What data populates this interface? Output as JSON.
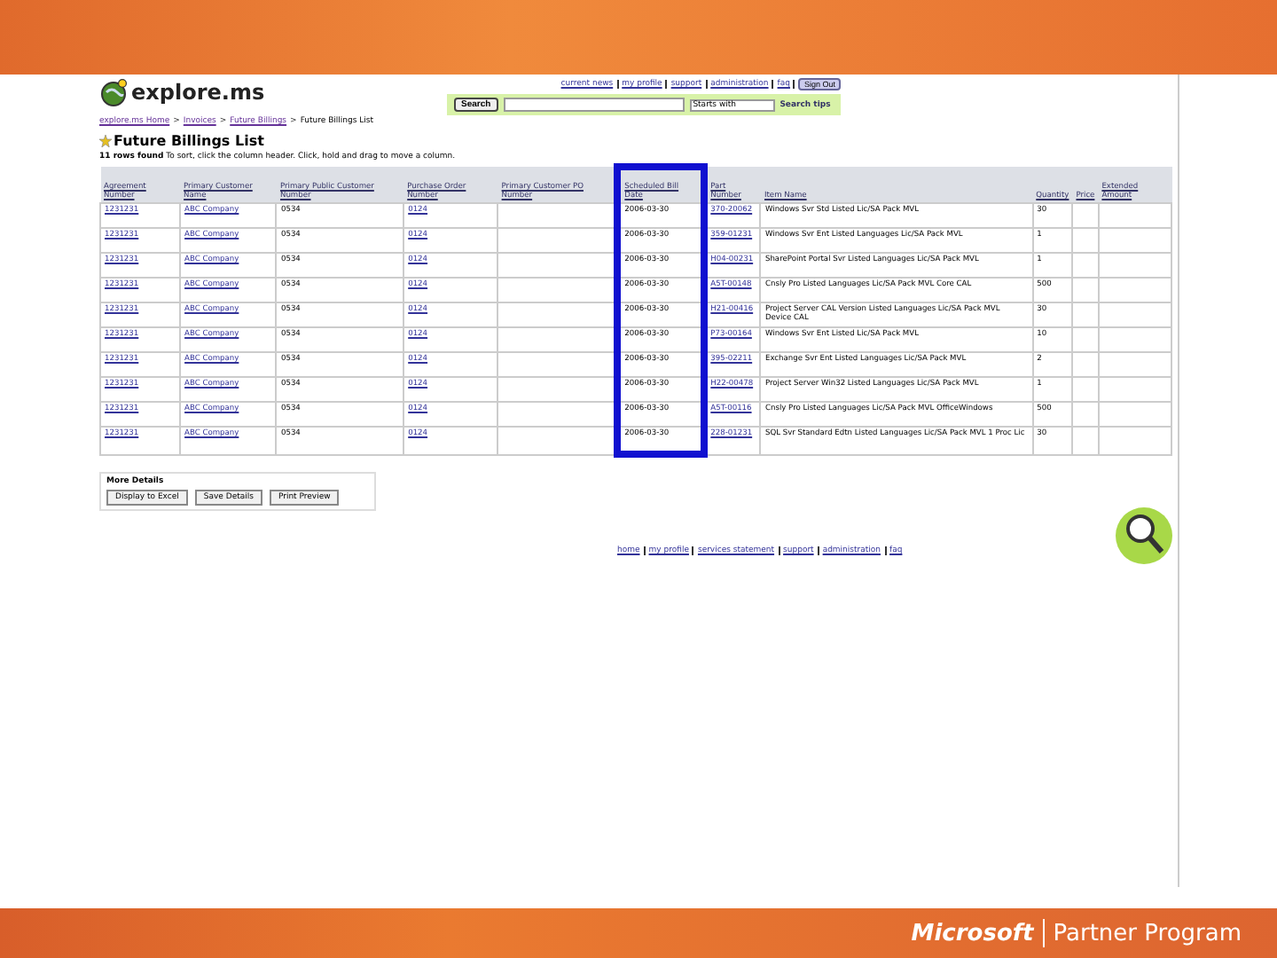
{
  "site": {
    "logo": "explore.ms",
    "top_links": [
      "current news",
      "my profile",
      "support",
      "administration",
      "faq"
    ],
    "sign_out": "Sign Out",
    "search_button": "Search",
    "search_mode": "Starts with",
    "search_tips": "Search tips"
  },
  "breadcrumb_separator": ">",
  "breadcrumb": [
    "explore.ms Home",
    "Invoices",
    "Future Billings",
    "Future Billings List"
  ],
  "page_title": "Future Billings List",
  "status": {
    "count": "11 rows found",
    "hint": "To sort, click the column header. Click, hold and drag to move a column."
  },
  "table": {
    "columns": [
      {
        "label": "Agreement Number",
        "highlighted": false
      },
      {
        "label": "Primary Customer Name",
        "highlighted": false
      },
      {
        "label": "Primary Public Customer Number",
        "highlighted": false
      },
      {
        "label": "Purchase Order Number",
        "highlighted": false
      },
      {
        "label": "Primary Customer PO Number",
        "highlighted": false
      },
      {
        "label": "Scheduled Bill Date",
        "highlighted": true
      },
      {
        "label": "Part Number",
        "highlighted": false
      },
      {
        "label": "Item Name",
        "highlighted": false
      },
      {
        "label": "Quantity",
        "highlighted": false
      },
      {
        "label": "Price",
        "highlighted": false
      },
      {
        "label": "Extended Amount",
        "highlighted": false
      }
    ],
    "rows": [
      [
        "1231231",
        "ABC Company",
        "0534",
        "0124",
        "",
        "2006-03-30",
        "370-20062",
        "Windows Svr Std Listed Lic/SA Pack MVL",
        "30",
        "",
        ""
      ],
      [
        "1231231",
        "ABC Company",
        "0534",
        "0124",
        "",
        "2006-03-30",
        "359-01231",
        "Windows Svr Ent Listed Languages Lic/SA Pack MVL",
        "1",
        "",
        ""
      ],
      [
        "1231231",
        "ABC Company",
        "0534",
        "0124",
        "",
        "2006-03-30",
        "H04-00231",
        "SharePoint Portal Svr Listed Languages Lic/SA Pack MVL",
        "1",
        "",
        ""
      ],
      [
        "1231231",
        "ABC Company",
        "0534",
        "0124",
        "",
        "2006-03-30",
        "A5T-00148",
        "Cnsly Pro Listed Languages Lic/SA Pack MVL Core CAL",
        "500",
        "",
        ""
      ],
      [
        "1231231",
        "ABC Company",
        "0534",
        "0124",
        "",
        "2006-03-30",
        "H21-00416",
        "Project Server CAL Version Listed Languages Lic/SA Pack MVL Device CAL",
        "30",
        "",
        ""
      ],
      [
        "1231231",
        "ABC Company",
        "0534",
        "0124",
        "",
        "2006-03-30",
        "P73-00164",
        "Windows Svr Ent Listed Lic/SA Pack MVL",
        "10",
        "",
        ""
      ],
      [
        "1231231",
        "ABC Company",
        "0534",
        "0124",
        "",
        "2006-03-30",
        "395-02211",
        "Exchange Svr Ent Listed Languages Lic/SA Pack MVL",
        "2",
        "",
        ""
      ],
      [
        "1231231",
        "ABC Company",
        "0534",
        "0124",
        "",
        "2006-03-30",
        "H22-00478",
        "Project Server Win32 Listed Languages Lic/SA Pack MVL",
        "1",
        "",
        ""
      ],
      [
        "1231231",
        "ABC Company",
        "0534",
        "0124",
        "",
        "2006-03-30",
        "A5T-00116",
        "Cnsly Pro Listed Languages Lic/SA Pack MVL OfficeWindows",
        "500",
        "",
        ""
      ],
      [
        "1231231",
        "ABC Company",
        "0534",
        "0124",
        "",
        "2006-03-30",
        "228-01231",
        "SQL Svr Standard Edtn Listed Languages Lic/SA Pack MVL 1 Proc Lic",
        "30",
        "",
        ""
      ]
    ]
  },
  "more_details": {
    "title": "More Details",
    "buttons": [
      "Display to Excel",
      "Save Details",
      "Print Preview"
    ]
  },
  "footer_links": [
    "home",
    "my profile",
    "services statement",
    "support",
    "administration",
    "faq"
  ],
  "slide_footer": {
    "brand": "Microsoft",
    "program": "Partner Program"
  }
}
